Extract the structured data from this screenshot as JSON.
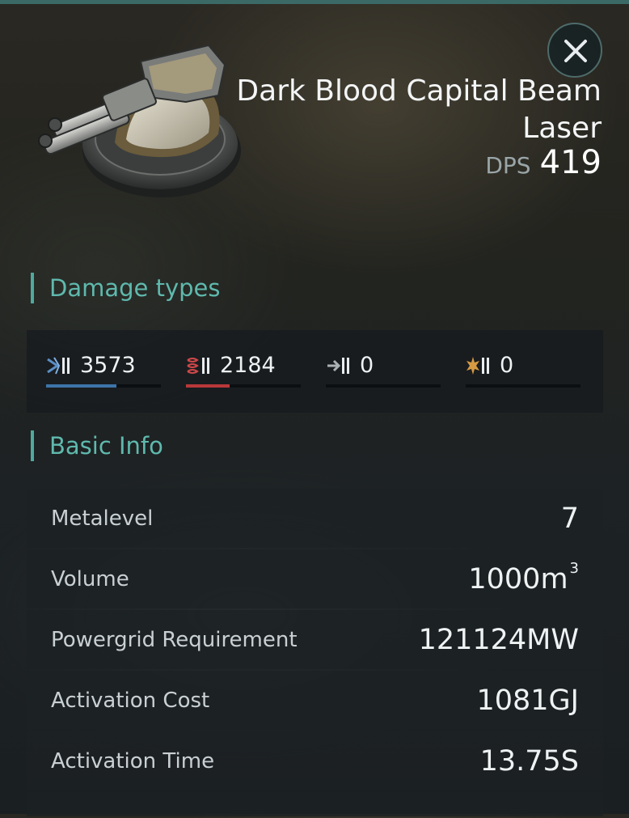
{
  "item": {
    "name": "Dark Blood Capital Beam Laser",
    "dps_label": "DPS",
    "dps_value": "419"
  },
  "sections": {
    "damage_types": "Damage types",
    "basic_info": "Basic Info"
  },
  "damage": [
    {
      "type": "em",
      "icon": "em-damage-icon",
      "value": "3573",
      "fraction": 0.61,
      "color": "#3d74a8"
    },
    {
      "type": "thermal",
      "icon": "thermal-damage-icon",
      "value": "2184",
      "fraction": 0.38,
      "color": "#b8383a"
    },
    {
      "type": "kinetic",
      "icon": "kinetic-damage-icon",
      "value": "0",
      "fraction": 0,
      "color": "#8a9294"
    },
    {
      "type": "explosive",
      "icon": "explosive-damage-icon",
      "value": "0",
      "fraction": 0,
      "color": "#c9893a"
    }
  ],
  "basic_info": [
    {
      "label": "Metalevel",
      "value": "7"
    },
    {
      "label": "Volume",
      "value": "1000m",
      "sup": "3"
    },
    {
      "label": "Powergrid Requirement",
      "value": "121124MW"
    },
    {
      "label": "Activation Cost",
      "value": "1081GJ"
    },
    {
      "label": "Activation Time",
      "value": "13.75S"
    }
  ],
  "icons": {
    "close": "close-icon",
    "item": "beam-laser-turret-icon"
  }
}
